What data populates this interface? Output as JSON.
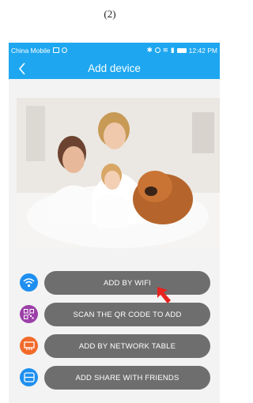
{
  "caption": "(2)",
  "status_bar": {
    "carrier": "China Mobile",
    "time": "12:42 PM"
  },
  "header": {
    "title": "Add device"
  },
  "actions": [
    {
      "label": "ADD BY WIFI",
      "icon": "wifi-icon",
      "color": "#1e8ff0"
    },
    {
      "label": "SCAN THE QR CODE TO ADD",
      "icon": "qr-code-icon",
      "color": "#9c3fa8"
    },
    {
      "label": "ADD BY NETWORK TABLE",
      "icon": "network-cable-icon",
      "color": "#f26a2a"
    },
    {
      "label": "ADD SHARE WITH FRIENDS",
      "icon": "share-icon",
      "color": "#1e8ff0"
    }
  ],
  "colors": {
    "header": "#1ea7f0",
    "button": "#6e6e6e",
    "pointer": "#e8231e"
  }
}
